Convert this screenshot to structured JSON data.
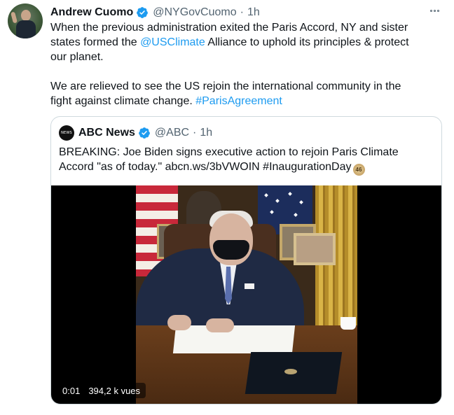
{
  "tweet": {
    "author_name": "Andrew Cuomo",
    "handle": "@NYGovCuomo",
    "separator": "·",
    "time": "1h",
    "lines": [
      {
        "pre": "When the previous administration exited the Paris Accord, NY and sister",
        "link": "",
        "post": ""
      },
      {
        "pre": "states formed the ",
        "link": "@USClimate",
        "post": " Alliance to uphold its principles & protect"
      },
      {
        "pre": "our planet.",
        "link": "",
        "post": ""
      },
      {
        "pre": "",
        "link": "",
        "post": ""
      },
      {
        "pre": "We are relieved to see the US rejoin the international community in the",
        "link": "",
        "post": ""
      },
      {
        "pre": "fight against climate change. ",
        "link": "#ParisAgreement",
        "post": ""
      }
    ]
  },
  "quote": {
    "author_name": "ABC News",
    "handle": "@ABC",
    "separator": "·",
    "time": "1h",
    "logo_text": "NEWS",
    "line1": "BREAKING: Joe Biden signs executive action to rejoin Paris Climate",
    "line2": "Accord \"as of today.\" abcn.ws/3bVWOIN #InaugurationDay",
    "badge": "46",
    "video": {
      "elapsed": "0:01",
      "views": "394,2 k vues"
    }
  },
  "icons": {
    "avatar": "profile-photo",
    "verified": "verified-badge-icon",
    "more": "more-options-icon"
  },
  "colors": {
    "link": "#1d9bf0",
    "verified": "#1d9bf0",
    "muted": "#536471",
    "border": "#cfd9de"
  }
}
